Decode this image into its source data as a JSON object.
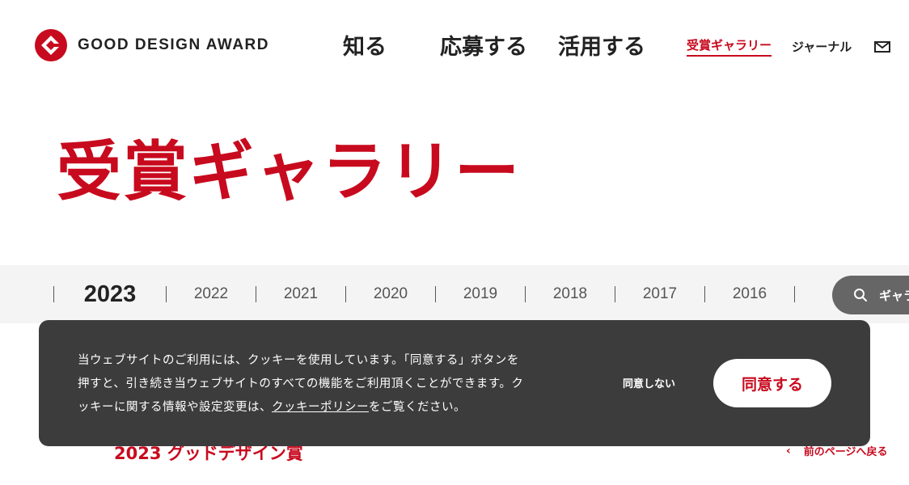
{
  "header": {
    "logo_text": "GOOD DESIGN AWARD",
    "main_nav": [
      "知る",
      "応募する",
      "活用する"
    ],
    "sub_nav": {
      "gallery": "受賞ギャラリー",
      "journal": "ジャーナル"
    }
  },
  "page_title": "受賞ギャラリー",
  "years": {
    "current": "2023",
    "others": [
      "2022",
      "2021",
      "2020",
      "2019",
      "2018",
      "2017",
      "2016"
    ]
  },
  "search": {
    "label": "ギャラリ"
  },
  "section": {
    "title": "2023 グッドデザイン賞",
    "back_link": "前のページへ戻る"
  },
  "cookie": {
    "line1": "当ウェブサイトのご利用には、クッキーを使用しています。「同意する」ボタンを",
    "line2": "押すと、引き続き当ウェブサイトのすべての機能をご利用頂くことができます。ク",
    "line3_pre": "ッキーに関する情報や設定変更は、",
    "policy_link": "クッキーポリシー",
    "line3_post": "をご覧ください。",
    "decline": "同意しない",
    "agree": "同意する"
  },
  "colors": {
    "accent": "#c80a1e",
    "banner_bg": "#3c3c3c",
    "year_bar_bg": "#f4f4f4"
  }
}
